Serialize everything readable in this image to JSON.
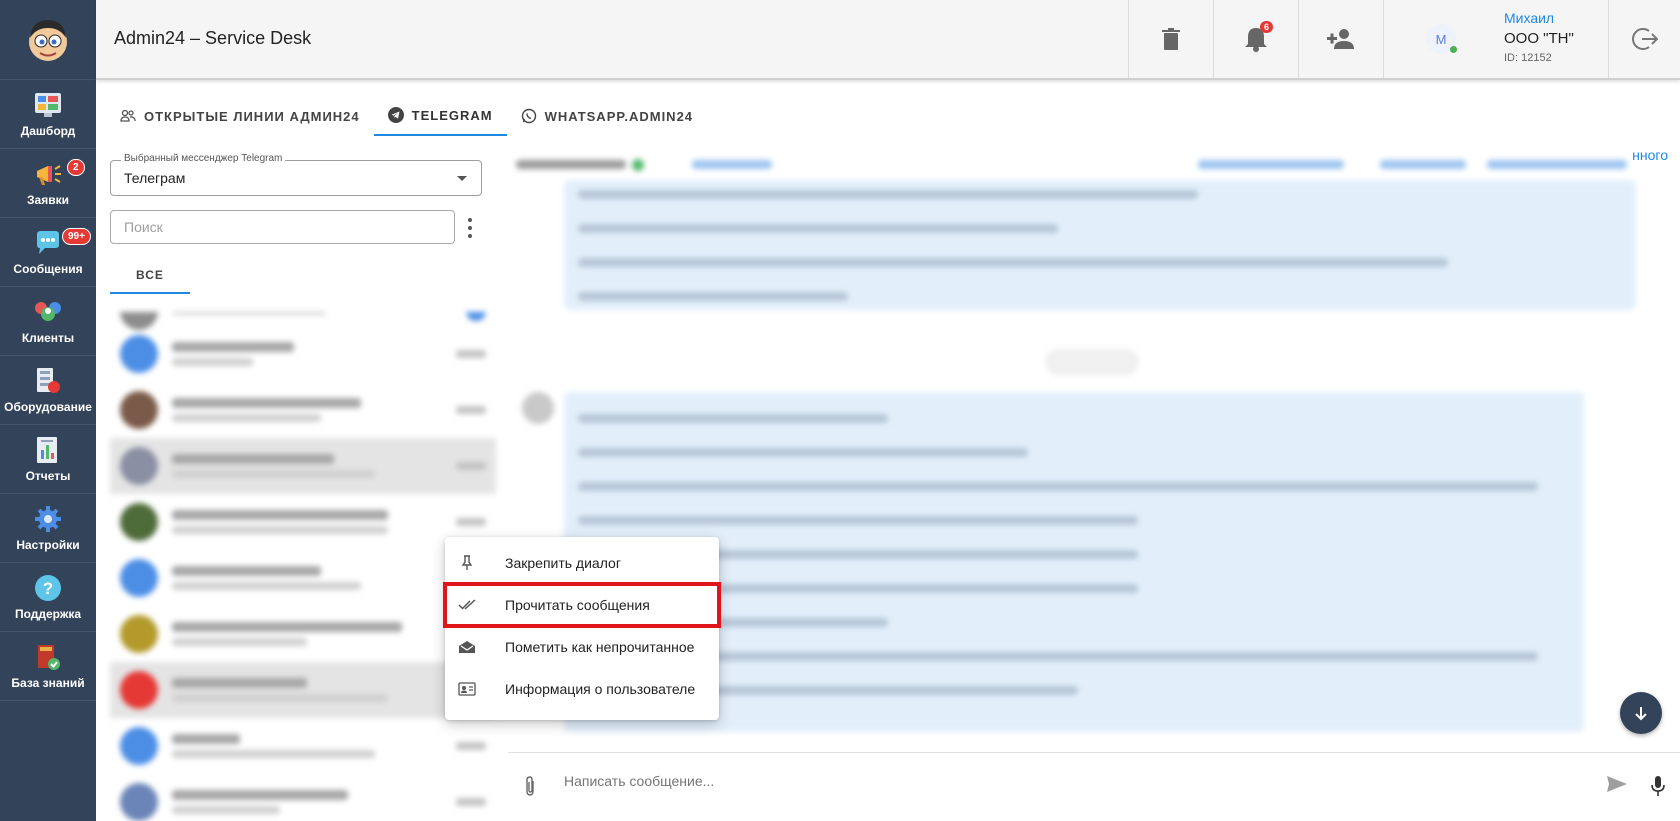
{
  "app": {
    "title": "Admin24 – Service Desk"
  },
  "sidebar": {
    "items": [
      {
        "label": "Дашборд",
        "badge": ""
      },
      {
        "label": "Заявки",
        "badge": "2"
      },
      {
        "label": "Сообщения",
        "badge": "99+"
      },
      {
        "label": "Клиенты",
        "badge": ""
      },
      {
        "label": "Оборудование",
        "badge": ""
      },
      {
        "label": "Отчеты",
        "badge": ""
      },
      {
        "label": "Настройки",
        "badge": ""
      },
      {
        "label": "Поддержка",
        "badge": ""
      },
      {
        "label": "База знаний",
        "badge": ""
      }
    ]
  },
  "header": {
    "notifications_count": "6",
    "user": {
      "avatar_letter": "М",
      "name": "Михаил",
      "org": "ООО \"ТН\"",
      "id": "ID: 12152"
    }
  },
  "tabs": [
    {
      "label": "ОТКРЫТЫЕ ЛИНИИ АДМИН24",
      "active": false
    },
    {
      "label": "TELEGRAM",
      "active": true
    },
    {
      "label": "WHATSAPP.ADMIN24",
      "active": false
    }
  ],
  "left": {
    "messenger_label": "Выбранный мессенджер Telegram",
    "messenger_value": "Телеграм",
    "search_placeholder": "Поиск",
    "filter_tab": "ВСЕ"
  },
  "conversation": {
    "remove_link_tail": "нного",
    "composer_placeholder": "Написать сообщение..."
  },
  "context_menu": {
    "items": [
      {
        "label": "Закрепить диалог",
        "icon": "pin-icon"
      },
      {
        "label": "Прочитать сообщения",
        "icon": "double-check-icon",
        "highlighted": true
      },
      {
        "label": "Пометить как непрочитанное",
        "icon": "open-envelope-icon"
      },
      {
        "label": "Информация о пользователе",
        "icon": "id-card-icon"
      }
    ]
  },
  "colors": {
    "sidebar": "#33435a",
    "accent": "#1e88e5",
    "badge": "#e53935",
    "highlight": "#e0151b"
  }
}
